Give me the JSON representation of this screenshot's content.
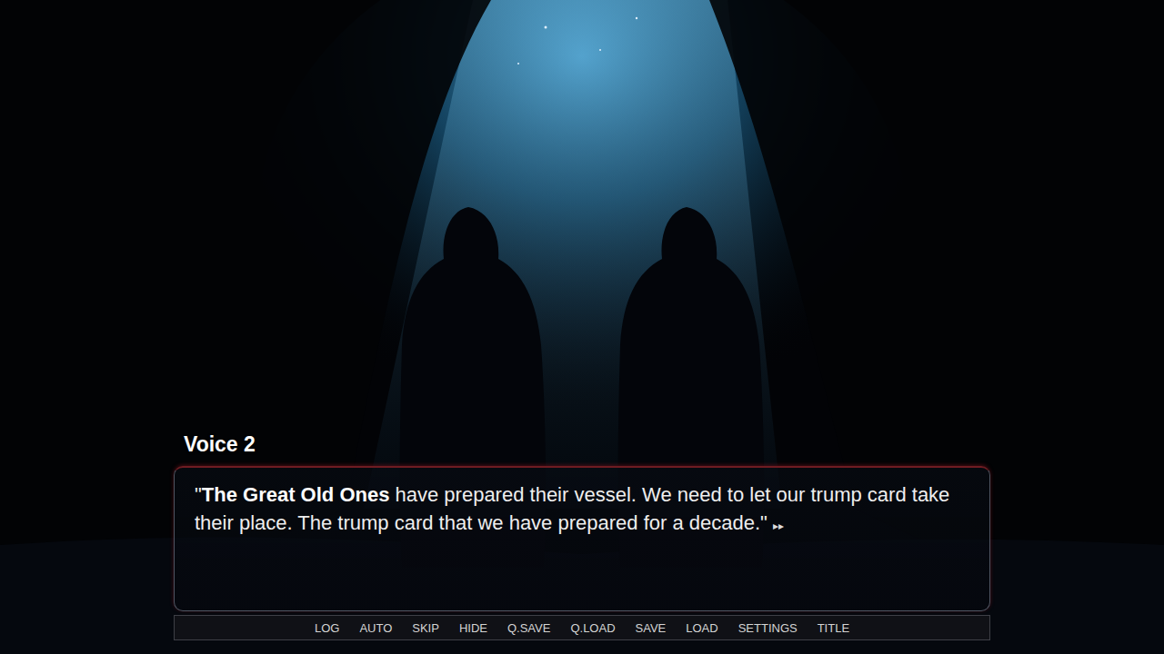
{
  "dialogue": {
    "speaker": "Voice 2",
    "segments": [
      {
        "text": "\"",
        "bold": false
      },
      {
        "text": "The Great Old Ones",
        "bold": true
      },
      {
        "text": " have prepared their vessel. We need to let our trump card take their place. The trump card that we have prepared for a decade.\"",
        "bold": false
      }
    ],
    "continue_indicator": "▸▸"
  },
  "menu": {
    "items": [
      "LOG",
      "AUTO",
      "SKIP",
      "HIDE",
      "Q.SAVE",
      "Q.LOAD",
      "SAVE",
      "LOAD",
      "SETTINGS",
      "TITLE"
    ]
  }
}
